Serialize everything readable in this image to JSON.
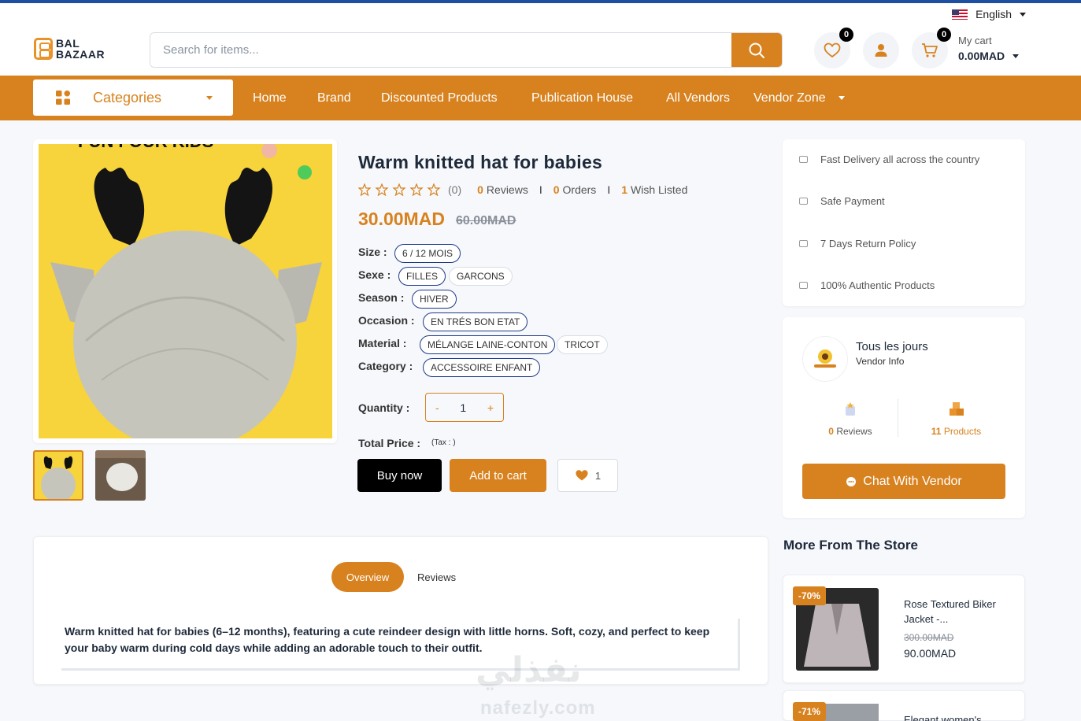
{
  "topbar": {
    "language": "English"
  },
  "header": {
    "logo_line1": "BAL",
    "logo_line2": "BAZAAR",
    "search_placeholder": "Search for items...",
    "wishlist_count": "0",
    "cart_count": "0",
    "cart_label": "My cart",
    "cart_amount": "0.00MAD"
  },
  "nav": {
    "categories_label": "Categories",
    "items": [
      "Home",
      "Brand",
      "Discounted Products",
      "Publication House",
      "All Vendors",
      "Vendor Zone"
    ]
  },
  "product": {
    "title": "Warm knitted hat for babies",
    "rating_count": "(0)",
    "reviews_count": "0",
    "reviews_label": "Reviews",
    "orders_count": "0",
    "orders_label": "Orders",
    "wish_count": "1",
    "wish_label": "Wish Listed",
    "price": "30.00MAD",
    "old_price": "60.00MAD",
    "attributes": [
      {
        "label": "Size :",
        "values": [
          "6 / 12 MOIS"
        ]
      },
      {
        "label": "Sexe :",
        "values": [
          "FILLES",
          "GARCONS"
        ]
      },
      {
        "label": "Season :",
        "values": [
          "HIVER"
        ]
      },
      {
        "label": "Occasion :",
        "values": [
          "EN TRÉS BON ETAT"
        ]
      },
      {
        "label": "Material :",
        "values": [
          "MÉLANGE LAINE-CONTON",
          "TRICOT"
        ]
      },
      {
        "label": "Category :",
        "values": [
          "ACCESSOIRE ENFANT"
        ]
      }
    ],
    "quantity_label": "Quantity :",
    "quantity_minus": "-",
    "quantity_value": "1",
    "quantity_plus": "+",
    "total_label": "Total Price :",
    "tax_label": "(Tax : )",
    "buy_now": "Buy now",
    "add_to_cart": "Add to cart",
    "wish_button_count": "1",
    "image_top_text": "FUN FOUR KIDS"
  },
  "features": [
    "Fast Delivery all across the country",
    "Safe Payment",
    "7 Days Return Policy",
    "100% Authentic Products"
  ],
  "vendor": {
    "name": "Tous les jours",
    "info_label": "Vendor Info",
    "reviews_count": "0",
    "reviews_label": "Reviews",
    "products_count": "11",
    "products_label": "Products",
    "chat_label": "Chat With Vendor"
  },
  "tabs": {
    "overview": "Overview",
    "reviews": "Reviews"
  },
  "description": "Warm knitted hat for babies (6–12 months), featuring a cute reindeer design with little horns. Soft, cozy, and perfect to keep your baby warm during cold days while adding an adorable touch to their outfit.",
  "more_from_store": {
    "title": "More From The Store",
    "items": [
      {
        "discount": "-70%",
        "name": "Rose Textured Biker Jacket -...",
        "old_price": "300.00MAD",
        "price": "90.00MAD"
      },
      {
        "discount": "-71%",
        "name": "Elegant women's"
      }
    ]
  },
  "watermark": {
    "arabic": "نفذلي",
    "latin": "nafezly.com"
  },
  "colors": {
    "accent": "#d8821f",
    "dark": "#1e2a3a",
    "border_blue": "#1e3a8a"
  }
}
